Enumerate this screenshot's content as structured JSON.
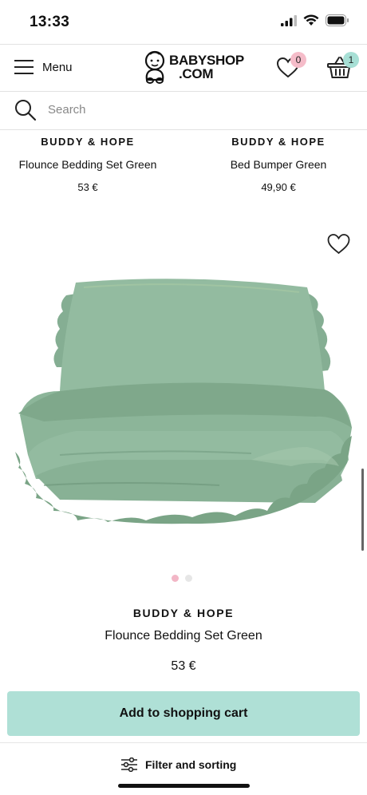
{
  "status": {
    "time": "13:33"
  },
  "header": {
    "menu_label": "Menu",
    "logo_line1": "BABYSHOP",
    "logo_line2": ".COM",
    "wishlist_count": "0",
    "cart_count": "1"
  },
  "search": {
    "placeholder": "Search"
  },
  "products_top": [
    {
      "brand": "BUDDY & HOPE",
      "name": "Flounce Bedding Set Green",
      "price": "53 €"
    },
    {
      "brand": "BUDDY & HOPE",
      "name": "Bed Bumper Green",
      "price": "49,90 €"
    }
  ],
  "featured": {
    "brand": "BUDDY & HOPE",
    "name": "Flounce Bedding Set Green",
    "price": "53 €",
    "image_count": 2,
    "active_image": 1
  },
  "actions": {
    "add_to_cart": "Add to shopping cart",
    "filter": "Filter and sorting"
  },
  "colors": {
    "accent_mint": "#afe0d6",
    "badge_pink": "#f5bcc9",
    "badge_mint": "#a7dfd5",
    "dot_active": "#f2b6c6",
    "dot_inactive": "#e6e6e6",
    "product_green": "#8fb79d"
  }
}
